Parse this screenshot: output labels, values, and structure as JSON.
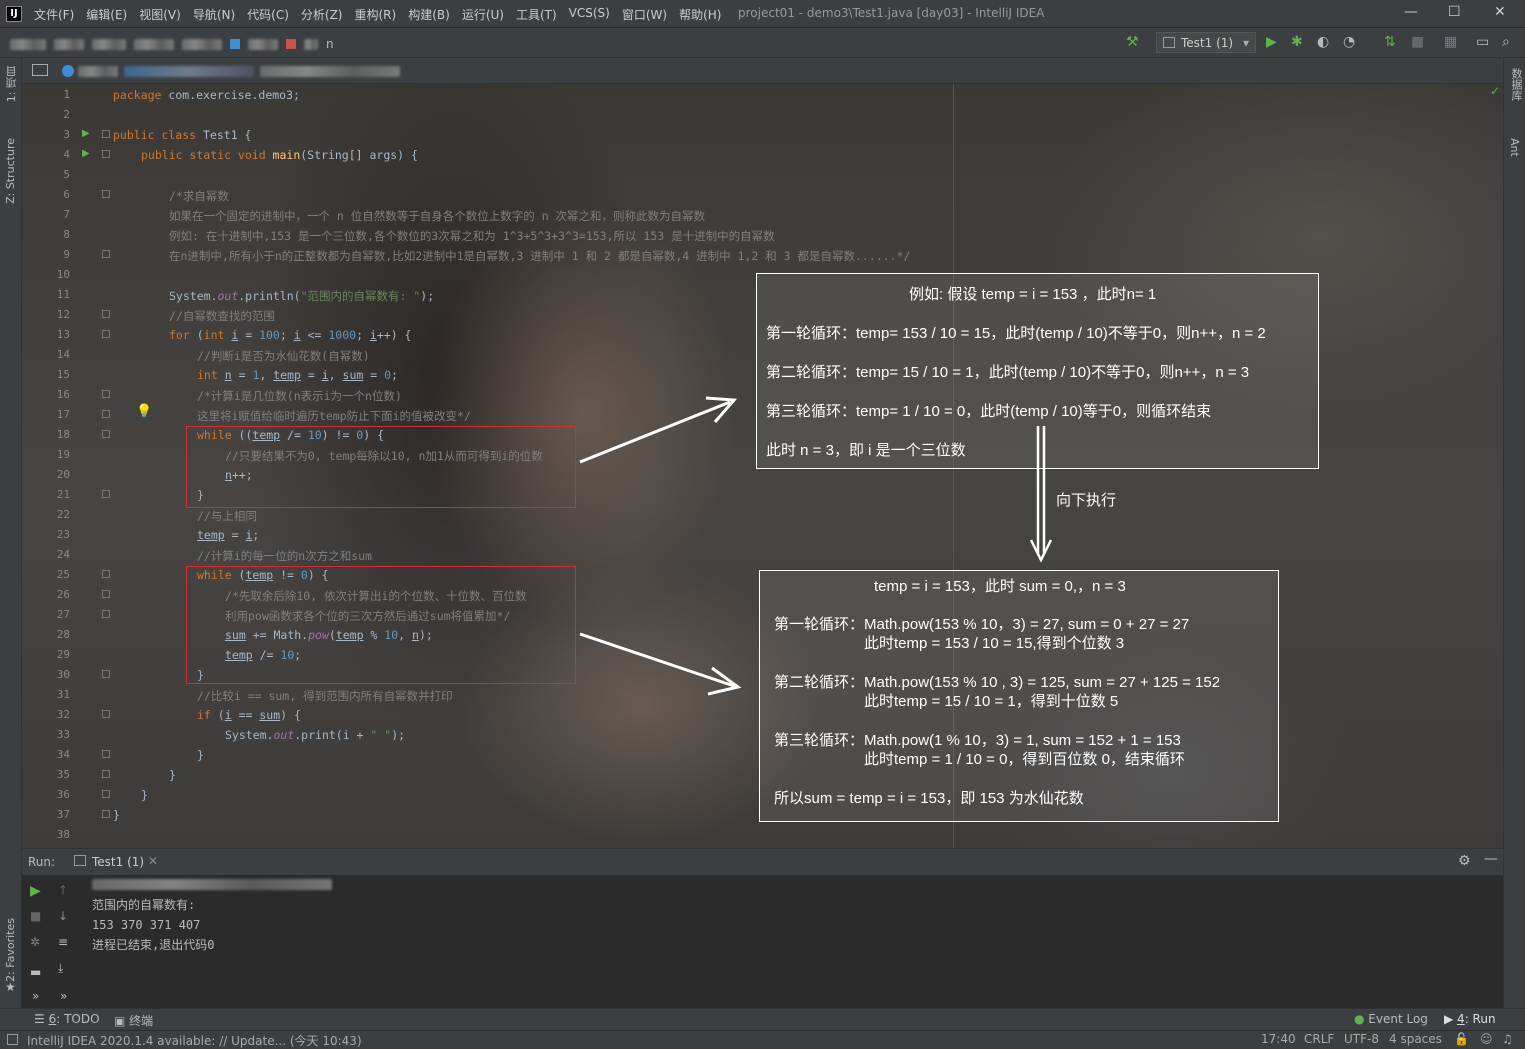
{
  "window": {
    "title": "project01 - demo3\\Test1.java [day03] - IntelliJ IDEA",
    "logo": "IJ",
    "controls": {
      "minimize": "—",
      "maximize": "☐",
      "close": "✕"
    }
  },
  "menu": [
    "文件(F)",
    "编辑(E)",
    "视图(V)",
    "导航(N)",
    "代码(C)",
    "分析(Z)",
    "重构(R)",
    "构建(B)",
    "运行(U)",
    "工具(T)",
    "VCS(S)",
    "窗口(W)",
    "帮助(H)"
  ],
  "toolbar": {
    "run_config": "Test1 (1)",
    "breadcrumb_tail": "n"
  },
  "left_strip": {
    "project": "1: 项目",
    "structure": "Z: Structure",
    "favorites": "2: Favorites"
  },
  "right_strip": {
    "database": "数据库",
    "ant": "Ant"
  },
  "editor": {
    "line_numbers": [
      "1",
      "2",
      "3",
      "4",
      "5",
      "6",
      "7",
      "8",
      "9",
      "10",
      "11",
      "12",
      "13",
      "14",
      "15",
      "16",
      "17",
      "18",
      "19",
      "20",
      "21",
      "22",
      "23",
      "24",
      "25",
      "26",
      "27",
      "28",
      "29",
      "30",
      "31",
      "32",
      "33",
      "34",
      "35",
      "36",
      "37",
      "38"
    ],
    "code": {
      "l1_kw": "package",
      "l1_rest": " com.exercise.demo3;",
      "l3_kw": "public class",
      "l3_rest": " Test1 {",
      "l4_kw": "public static void",
      "l4_fn": " main",
      "l4_rest": "(String[] args) {",
      "l6": "/*求自幂数",
      "l7": "如果在一个固定的进制中，一个 n 位自然数等于自身各个数位上数字的 n 次幂之和，则称此数为自幂数",
      "l8": "例如: 在十进制中,153 是一个三位数,各个数位的3次幂之和为 1^3+5^3+3^3=153,所以 153 是十进制中的自幂数",
      "l9": "在n进制中,所有小于n的正整数都为自幂数,比如2进制中1是自幂数,3 进制中 1 和 2 都是自幂数,4 进制中 1,2 和 3 都是自幂数......*/",
      "l11_a": "System.",
      "l11_out": "out",
      "l11_b": ".println(",
      "l11_str": "\"范围内的自幂数有: \"",
      "l11_c": ");",
      "l12": "//自幂数查找的范围",
      "l13_kw": "for",
      "l13_a": " (",
      "l13_kw2": "int",
      "l13_i": "i",
      "l13_b": " = ",
      "l13_n1": "100",
      "l13_c": "; ",
      "l13_i2": "i",
      "l13_d": " <= ",
      "l13_n2": "1000",
      "l13_e": "; ",
      "l13_i3": "i",
      "l13_f": "++) {",
      "l14": "//判断i是否为水仙花数(自幂数)",
      "l15_kw": "int",
      "l15_n": "n",
      "l15_a": " = ",
      "l15_one": "1",
      "l15_b": ", ",
      "l15_temp": "temp",
      "l15_c": " = ",
      "l15_i": "i",
      "l15_d": ", ",
      "l15_sum": "sum",
      "l15_e": " = ",
      "l15_zero": "0",
      "l15_f": ";",
      "l16": "/*计算i是几位数(n表示i为一个n位数)",
      "l17": "这里将i赋值给临时遍历temp防止下面i的值被改变*/",
      "l18_kw": "while",
      "l18_a": " ((",
      "l18_temp": "temp",
      "l18_b": " /= ",
      "l18_n": "10",
      "l18_c": ") != ",
      "l18_z": "0",
      "l18_d": ") {",
      "l19": "//只要结果不为0, temp每除以10, n加1从而可得到i的位数",
      "l20_n": "n",
      "l20_rest": "++;",
      "l21": "}",
      "l22": "//与上相同",
      "l23_temp": "temp",
      "l23_a": " = ",
      "l23_i": "i",
      "l23_b": ";",
      "l24": "//计算i的每一位的n次方之和sum",
      "l25_kw": "while",
      "l25_a": " (",
      "l25_temp": "temp",
      "l25_b": " != ",
      "l25_z": "0",
      "l25_c": ") {",
      "l26": "/*先取余后除10, 依次计算出i的个位数、十位数、百位数",
      "l27": "利用pow函数求各个位的三次方然后通过sum将值累加*/",
      "l28_sum": "sum",
      "l28_a": " += Math.",
      "l28_pow": "pow",
      "l28_b": "(",
      "l28_temp": "temp",
      "l28_c": " % ",
      "l28_n10": "10",
      "l28_d": ", ",
      "l28_n": "n",
      "l28_e": ");",
      "l29_temp": "temp",
      "l29_a": " /= ",
      "l29_n": "10",
      "l29_b": ";",
      "l30": "}",
      "l31": "//比较i == sum, 得到范围内所有自幂数并打印",
      "l32_kw": "if",
      "l32_a": " (",
      "l32_i": "i",
      "l32_b": " == ",
      "l32_sum": "sum",
      "l32_c": ") {",
      "l33_a": "System.",
      "l33_out": "out",
      "l33_b": ".print(i + ",
      "l33_str": "\" \"",
      "l33_c": ");",
      "brace": "}"
    }
  },
  "annotation1": {
    "title": "例如: 假设 temp = i = 153 ，此时n= 1",
    "r1": "第一轮循环：temp= 153 / 10 = 15，此时(temp / 10)不等于0，则n++，n = 2",
    "r2": "第二轮循环：temp= 15 / 10 = 1，此时(temp / 10)不等于0，则n++，n = 3",
    "r3": "第三轮循环：temp= 1 / 10 = 0，此时(temp / 10)等于0，则循环结束",
    "r4": "此时 n = 3，即 i 是一个三位数"
  },
  "arrow_label": "向下执行",
  "annotation2": {
    "title": "temp = i = 153，此时 sum = 0,，n = 3",
    "r1a": "第一轮循环：Math.pow(153 % 10，3) = 27, sum = 0 + 27 = 27",
    "r1b": "此时temp = 153 / 10 = 15,得到个位数 3",
    "r2a": "第二轮循环：Math.pow(153 % 10 , 3) = 125, sum = 27 + 125 = 152",
    "r2b": "此时temp = 15 / 10 = 1，得到十位数 5",
    "r3a": "第三轮循环：Math.pow(1 % 10，3) = 1, sum = 152 + 1 = 153",
    "r3b": "此时temp = 1 / 10 = 0，得到百位数 0，结束循环",
    "r4": "所以sum = temp = i = 153，即 153 为水仙花数"
  },
  "run_panel": {
    "label": "Run:",
    "tab": "Test1 (1)",
    "output": [
      "范围内的自幂数有:",
      "153 370 371 407",
      "进程已结束,退出代码0"
    ]
  },
  "bottom_tabs": {
    "todo_num": "6",
    "todo": ": TODO",
    "terminal": "终端",
    "event_log": "Event Log",
    "run_num": "4",
    "run": ": Run"
  },
  "status": {
    "message": "IntelliJ IDEA 2020.1.4 available: // Update... (今天 10:43)",
    "position": "17:40",
    "line_sep": "CRLF",
    "encoding": "UTF-8",
    "indent": "4 spaces"
  },
  "colors": {
    "keyword": "#cc7832",
    "string": "#6a8759",
    "comment": "#808080",
    "number": "#6897bb",
    "field": "#9876aa",
    "function": "#ffc66d",
    "highlight_box": "#d03030"
  }
}
